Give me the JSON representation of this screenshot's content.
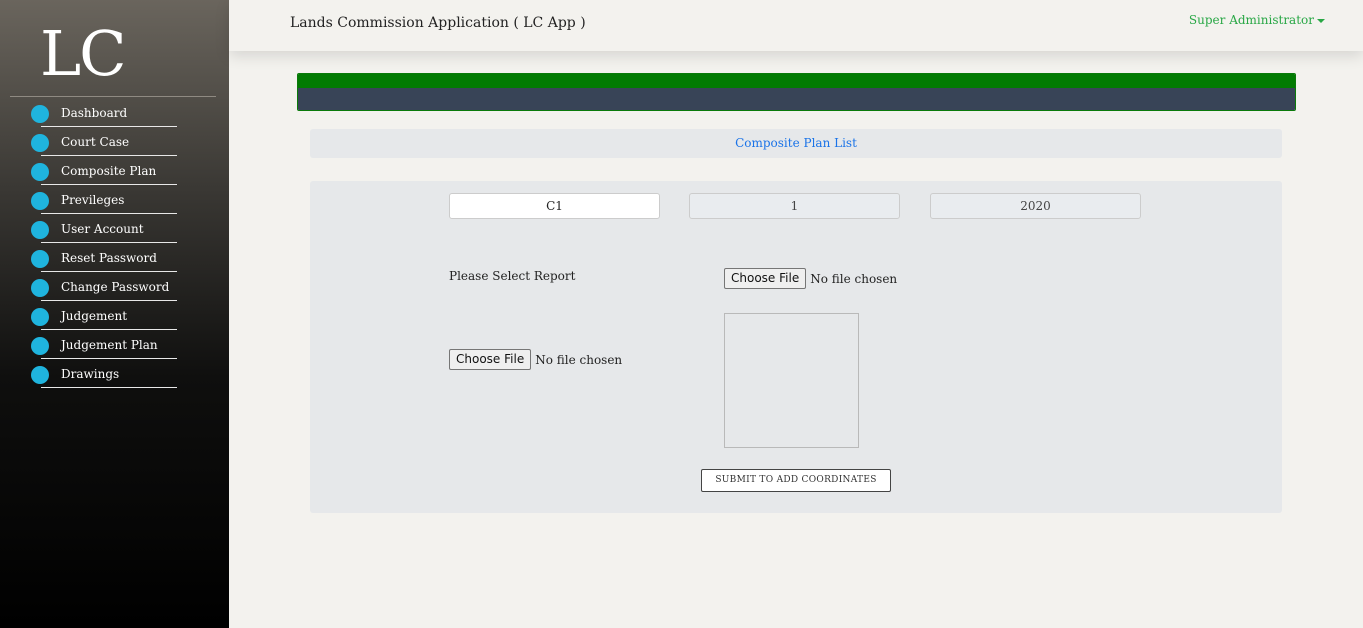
{
  "sidebar": {
    "logo": "LC",
    "items": [
      {
        "label": "Dashboard"
      },
      {
        "label": "Court Case"
      },
      {
        "label": "Composite Plan"
      },
      {
        "label": "Previleges"
      },
      {
        "label": "User Account"
      },
      {
        "label": "Reset Password"
      },
      {
        "label": "Change Password"
      },
      {
        "label": "Judgement"
      },
      {
        "label": "Judgement Plan"
      },
      {
        "label": "Drawings"
      }
    ]
  },
  "header": {
    "title": "Lands Commission Application ( LC App )",
    "user": "Super Administrator"
  },
  "breadcrumb": {
    "link": "Composite Plan List"
  },
  "form": {
    "code_value": "C1",
    "number_value": "1",
    "year_value": "2020",
    "report_label": "Please Select Report",
    "file1": {
      "button": "Choose File",
      "status": "No file chosen"
    },
    "file2": {
      "button": "Choose File",
      "status": "No file chosen"
    },
    "submit_label": "SUBMIT TO ADD COORDINATES"
  },
  "colors": {
    "accent_green": "#027b02",
    "banner_dark": "#384457",
    "nav_dot": "#1fb4de",
    "user_green": "#28a745",
    "link_blue": "#1a73e8"
  }
}
